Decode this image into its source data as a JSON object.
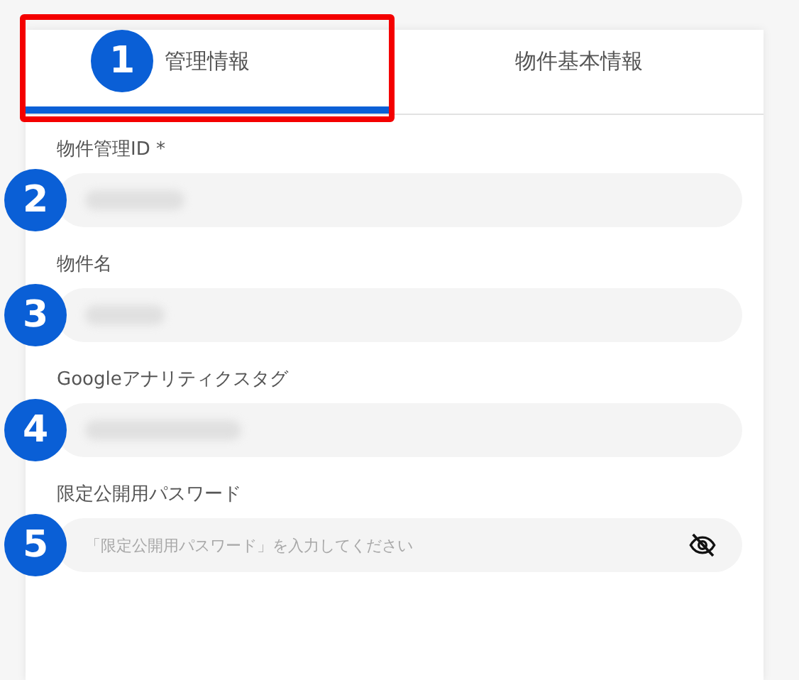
{
  "tabs": [
    {
      "label": "管理情報",
      "selected": true,
      "highlighted": true,
      "callout": "1"
    },
    {
      "label": "物件基本情報",
      "selected": false,
      "highlighted": false
    }
  ],
  "fields": [
    {
      "label": "物件管理ID *",
      "kind": "blurred",
      "callout": "2"
    },
    {
      "label": "物件名",
      "kind": "blurred",
      "callout": "3"
    },
    {
      "label": "Googleアナリティクスタグ",
      "kind": "blurred",
      "callout": "4"
    },
    {
      "label": "限定公開用パスワード",
      "kind": "password",
      "placeholder": "「限定公開用パスワード」を入力してください",
      "callout": "5"
    }
  ]
}
